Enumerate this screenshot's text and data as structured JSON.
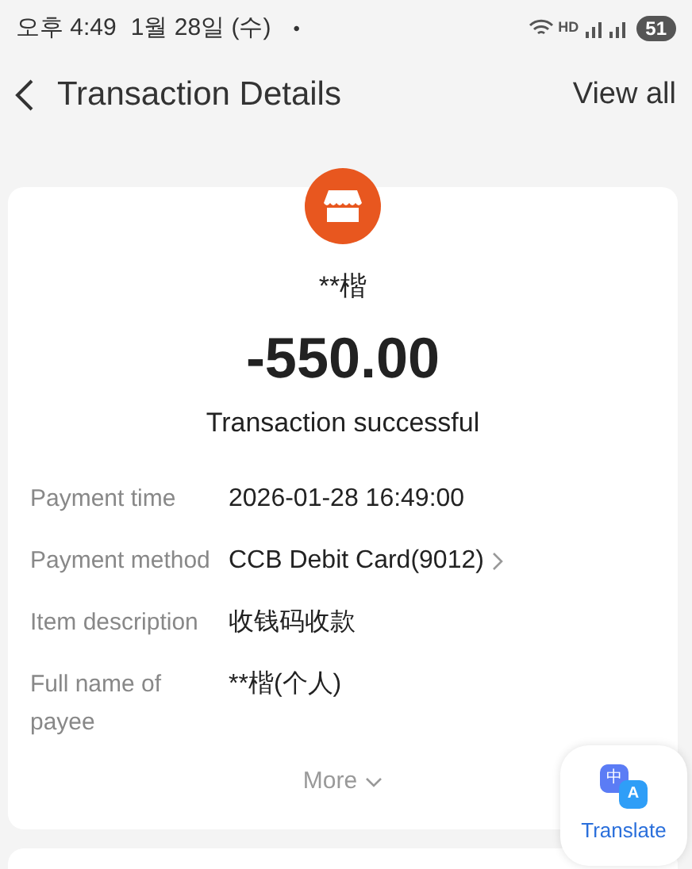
{
  "status_bar": {
    "time": "오후 4:49",
    "date": "1월 28일 (수)",
    "dot": "•",
    "network": "HD",
    "battery": "51"
  },
  "header": {
    "title": "Transaction Details",
    "action": "View all"
  },
  "transaction": {
    "payee": "**楷",
    "amount": "-550.00",
    "status": "Transaction successful"
  },
  "details": [
    {
      "label": "Payment time",
      "value": "2026-01-28 16:49:00",
      "link": false
    },
    {
      "label": "Payment method",
      "value": "CCB Debit Card(9012)",
      "link": true
    },
    {
      "label": "Item description",
      "value": "收钱码收款",
      "link": false
    },
    {
      "label": "Full name of payee",
      "value": "**楷(个人)",
      "link": false
    }
  ],
  "more": "More",
  "translate": {
    "glyph_1": "中",
    "glyph_2": "A",
    "label": "Translate"
  }
}
